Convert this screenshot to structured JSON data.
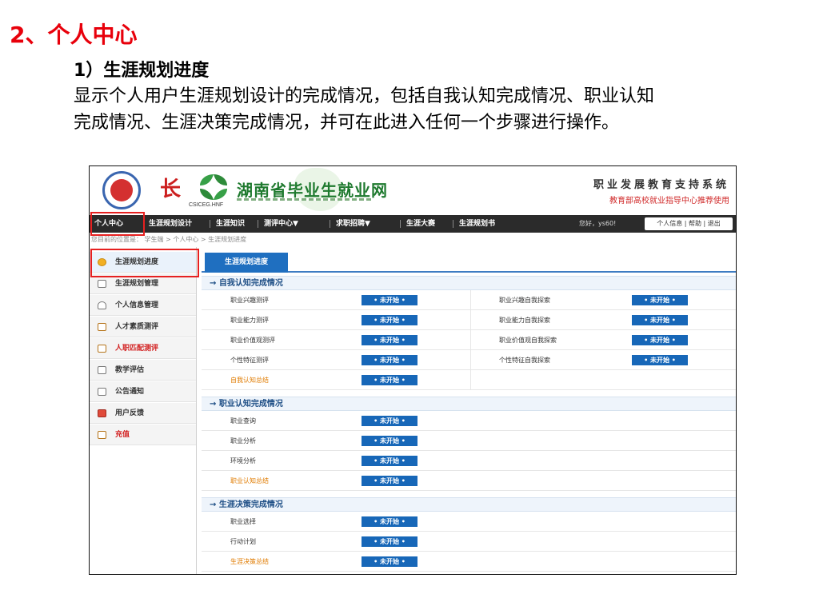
{
  "slide": {
    "title": "2、个人中心",
    "subtitle": "1）生涯规划进度",
    "description": "显示个人用户生涯规划设计的完成情况，包括自我认知完成情况、职业认知完成情况、生涯决策完成情况，并可在此进入任何一个步骤进行操作。"
  },
  "header": {
    "seal_icon": "university-seal-icon",
    "brush_char": "长",
    "leaf_logo_icon": "green-leaf-logo-icon",
    "leaf_caption": "CSICEG.HNF",
    "brand": "湖南省毕业生就业网",
    "system_name": "职业发展教育支持系统",
    "system_sub": "教育部高校就业指导中心推荐使用"
  },
  "nav": {
    "items": [
      "个人中心",
      "生涯规划设计",
      "生涯知识",
      "测评中心▼",
      "求职招聘▼",
      "生涯大赛",
      "生涯规划书"
    ],
    "greeting": "您好，ys60!",
    "links": "个人信息 | 帮助 | 退出"
  },
  "breadcrumb": "您目前的位置是： 学生端 > 个人中心 > 生涯规划进度",
  "sidebar": {
    "items": [
      {
        "label": "生涯规划进度",
        "icon": "progress-icon"
      },
      {
        "label": "生涯规划管理",
        "icon": "edit-icon"
      },
      {
        "label": "个人信息管理",
        "icon": "user-icon"
      },
      {
        "label": "人才素质测评",
        "icon": "document-icon"
      },
      {
        "label": "人职匹配测评",
        "icon": "document-icon"
      },
      {
        "label": "教学评估",
        "icon": "chart-icon"
      },
      {
        "label": "公告通知",
        "icon": "edit-icon"
      },
      {
        "label": "用户反馈",
        "icon": "feedback-icon"
      },
      {
        "label": "充值",
        "icon": "document-icon"
      }
    ]
  },
  "main": {
    "tab": "生涯规划进度",
    "sections": [
      {
        "title": "→ 自我认知完成情况",
        "rows": [
          {
            "left": "职业兴趣测评",
            "left_status": "• 未开始 •",
            "right": "职业兴趣自我探索",
            "right_status": "• 未开始 •"
          },
          {
            "left": "职业能力测评",
            "left_status": "• 未开始 •",
            "right": "职业能力自我探索",
            "right_status": "• 未开始 •"
          },
          {
            "left": "职业价值观测评",
            "left_status": "• 未开始 •",
            "right": "职业价值观自我探索",
            "right_status": "• 未开始 •"
          },
          {
            "left": "个性特征测评",
            "left_status": "• 未开始 •",
            "right": "个性特征自我探索",
            "right_status": "• 未开始 •"
          },
          {
            "left": "自我认知总结",
            "left_status": "• 未开始 •"
          }
        ]
      },
      {
        "title": "→ 职业认知完成情况",
        "rows": [
          {
            "left": "职业查询",
            "left_status": "• 未开始 •"
          },
          {
            "left": "职业分析",
            "left_status": "• 未开始 •"
          },
          {
            "left": "环境分析",
            "left_status": "• 未开始 •"
          },
          {
            "left": "职业认知总结",
            "left_status": "• 未开始 •"
          }
        ]
      },
      {
        "title": "→ 生涯决策完成情况",
        "rows": [
          {
            "left": "职业选择",
            "left_status": "• 未开始 •"
          },
          {
            "left": "行动计划",
            "left_status": "• 未开始 •"
          },
          {
            "left": "生涯决策总结",
            "left_status": "• 未开始 •"
          }
        ]
      }
    ]
  },
  "colors": {
    "accent_red": "#e8000b",
    "nav_bg": "#2b2b2b",
    "badge_blue": "#1767b8",
    "summary_orange": "#e07b00",
    "highlight_red": "#e62020"
  }
}
